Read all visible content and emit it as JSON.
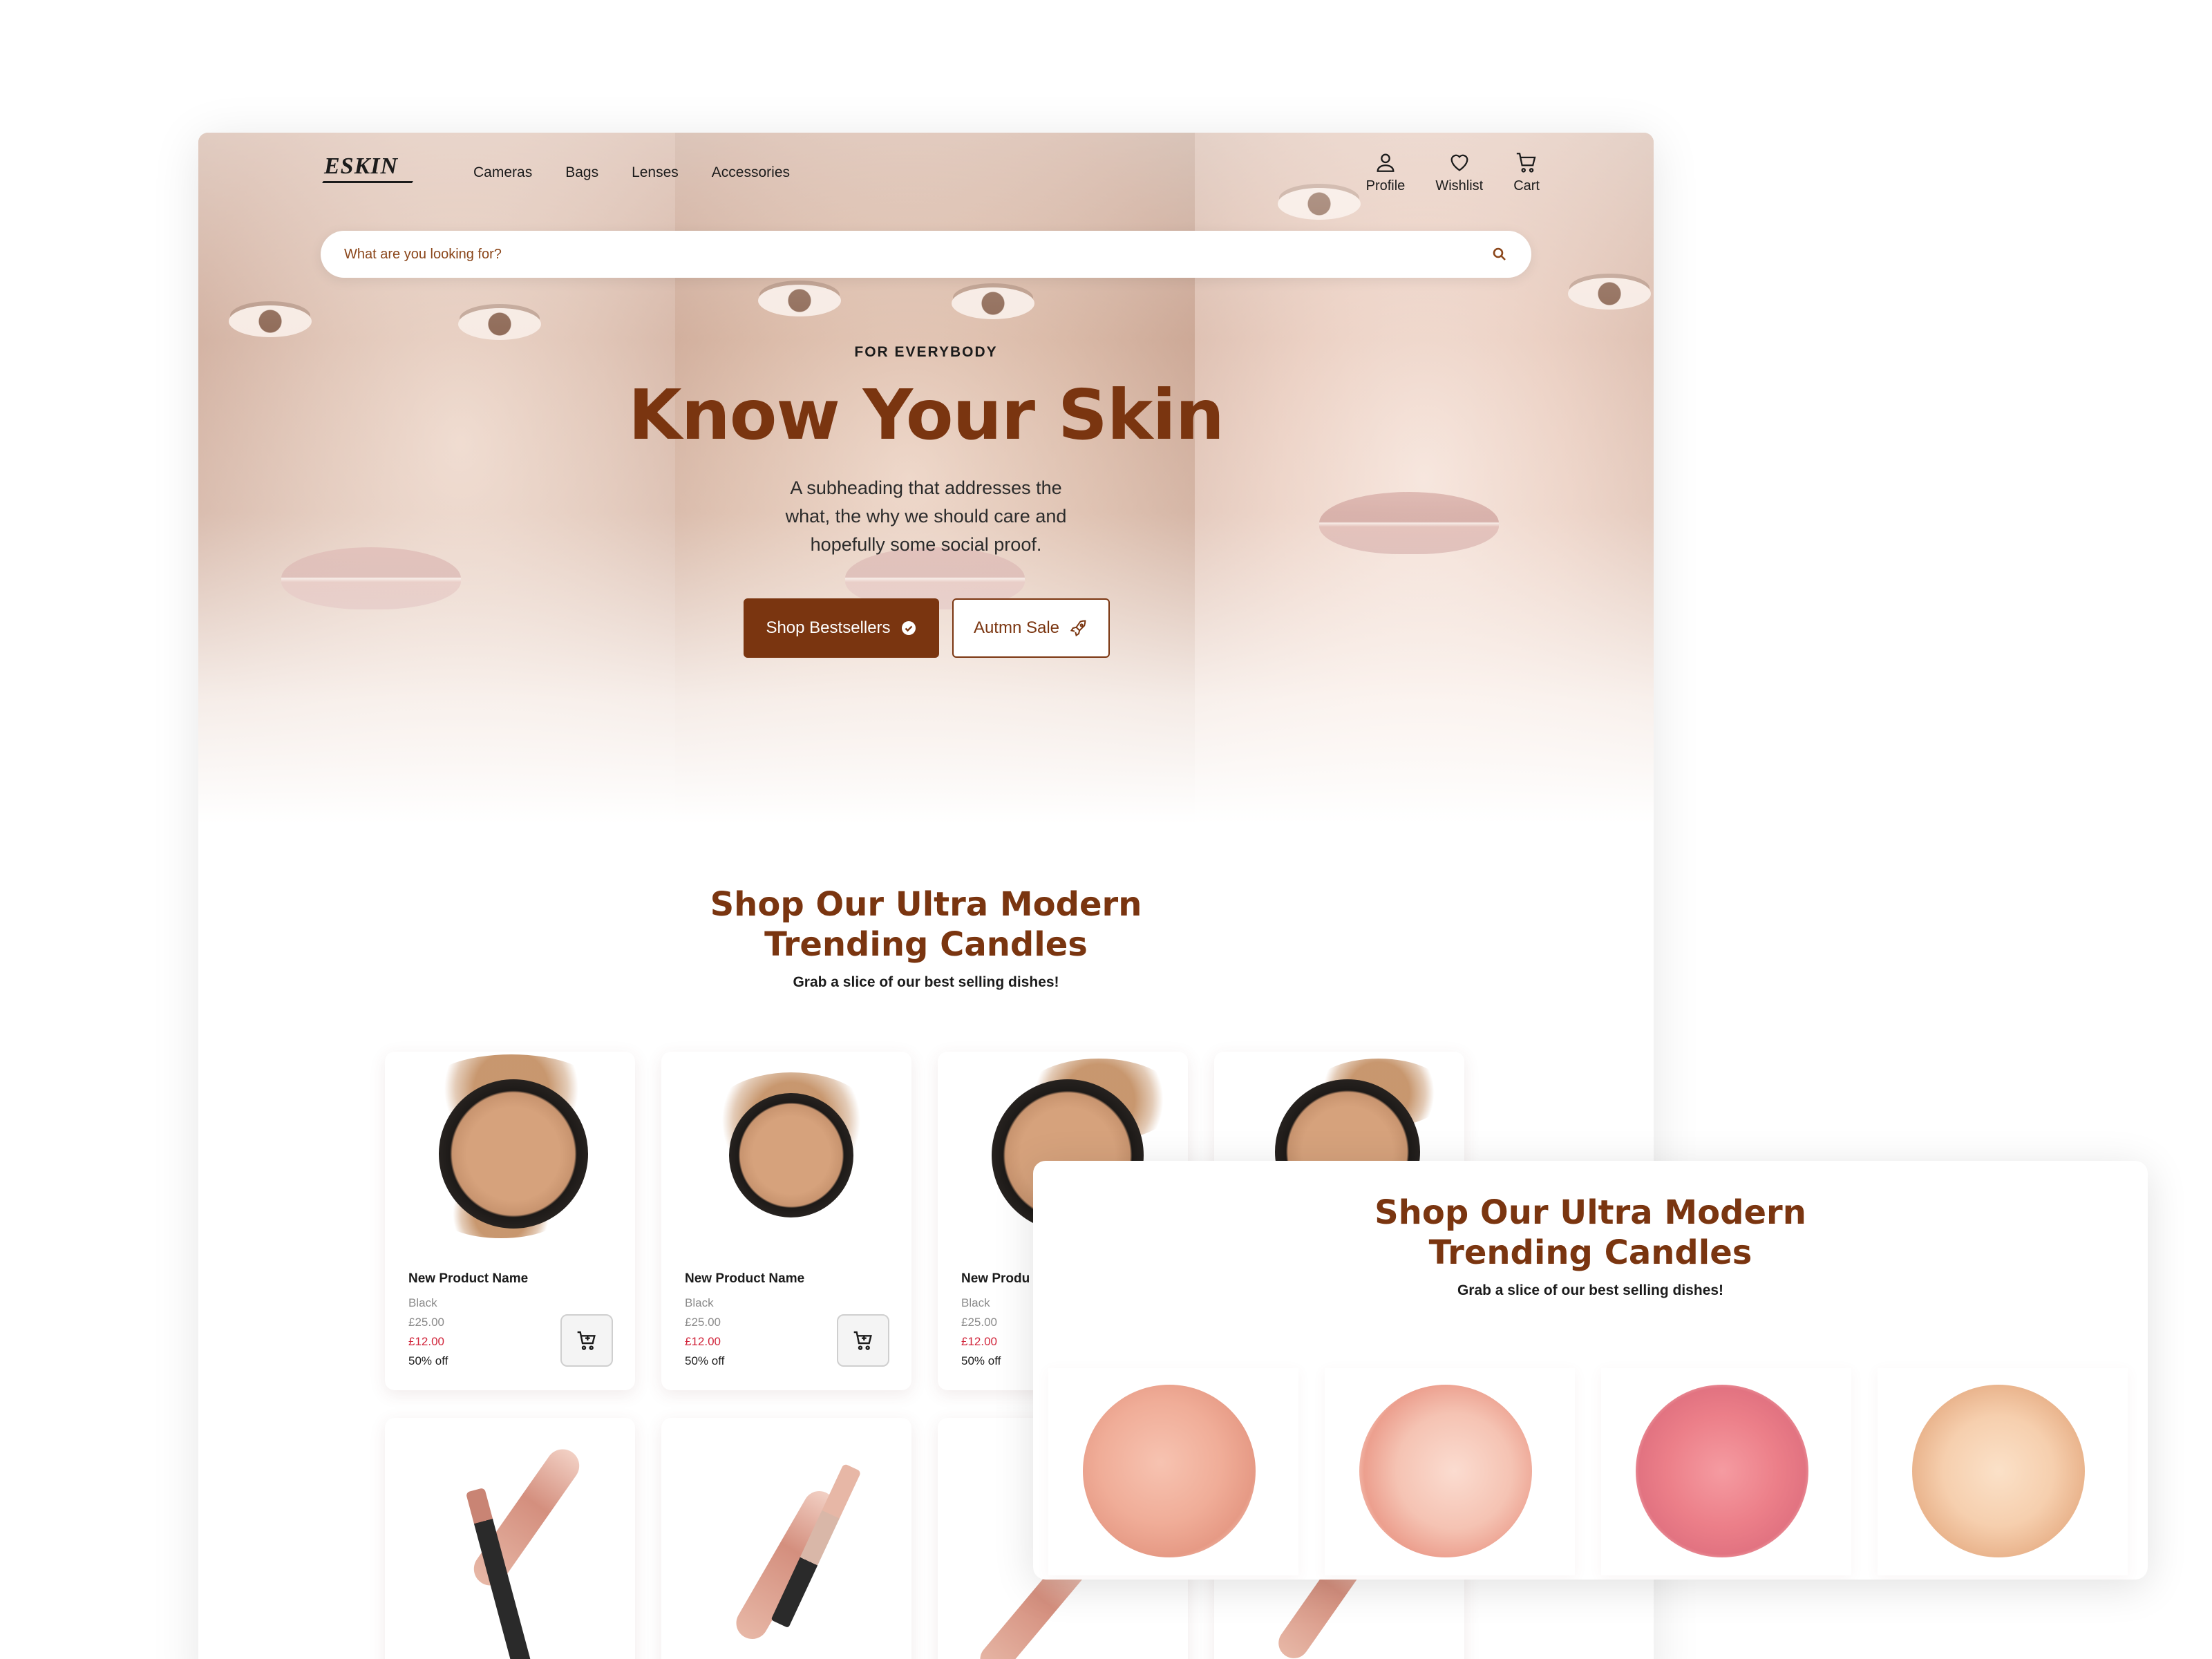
{
  "brand": {
    "logo": "ESKIN"
  },
  "nav": {
    "links": [
      "Cameras",
      "Bags",
      "Lenses",
      "Accessories"
    ],
    "icons": [
      {
        "label": "Profile",
        "icon": "user-icon"
      },
      {
        "label": "Wishlist",
        "icon": "heart-icon"
      },
      {
        "label": "Cart",
        "icon": "cart-icon"
      }
    ]
  },
  "search": {
    "placeholder": "What are you looking for?",
    "icon": "search-icon"
  },
  "hero": {
    "kicker": "FOR EVERYBODY",
    "title": "Know Your Skin",
    "subtitle_lines": [
      "A subheading that addresses the",
      "what, the why we should care and",
      "hopefully some social proof."
    ],
    "primary_button": "Shop Bestsellers",
    "secondary_button": "Autmn Sale"
  },
  "section": {
    "title_lines": [
      "Shop Our Ultra Modern",
      "Trending Candles"
    ],
    "subtitle": "Grab a slice of our best selling dishes!"
  },
  "products": [
    {
      "name": "New Product Name",
      "color": "Black",
      "old_price": "£25.00",
      "new_price": "£12.00",
      "discount": "50% off"
    },
    {
      "name": "New Product Name",
      "color": "Black",
      "old_price": "£25.00",
      "new_price": "£12.00",
      "discount": "50% off"
    },
    {
      "name": "New Produ",
      "color": "Black",
      "old_price": "£25.00",
      "new_price": "£12.00",
      "discount": "50% off"
    }
  ],
  "overlay": {
    "title_lines": [
      "Shop Our Ultra Modern",
      "Trending Candles"
    ],
    "subtitle": "Grab a slice of our best selling dishes!"
  },
  "colors": {
    "brand": "#7a3510",
    "price_sale": "#d1243a",
    "text": "#1b1b1b"
  }
}
